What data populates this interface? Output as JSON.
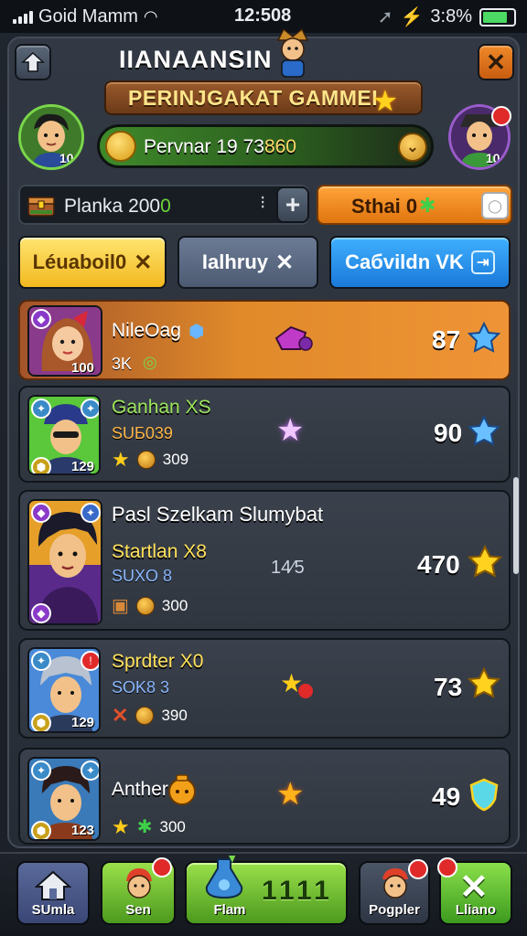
{
  "status": {
    "carrier": "Goid Mamm",
    "time": "12:508",
    "battery": "3:8%"
  },
  "header": {
    "title": "IIANAANSIN",
    "banner": "PERINJGAKAT GAMMEI"
  },
  "player": {
    "label": "Pervnar",
    "value_a": "19",
    "value_b": "73",
    "value_c": "860",
    "left_level": "10",
    "right_level": "10"
  },
  "plank": {
    "label": "Planka",
    "value_prefix": "200",
    "value_suffix": "0"
  },
  "stash": {
    "label": "Sthai 0"
  },
  "tabs": [
    {
      "label": "Léuaboil0",
      "x": "✕"
    },
    {
      "label": "Ialhruy",
      "x": "✕"
    },
    {
      "label": "Caбvildn VK",
      "x": "⇥"
    }
  ],
  "rows": [
    {
      "name": "NileOag",
      "sub": "3K",
      "level": "100",
      "score": "87"
    },
    {
      "name": "Ganhan",
      "tag": "XS",
      "sub": "SUБ039",
      "level": "129",
      "meta": "309",
      "score": "90"
    },
    {
      "title": "Pasl Szelkam Slumybat",
      "name": "Startlan",
      "tag": "X8",
      "sub": "SUXO 8",
      "level": "",
      "meta": "300",
      "mid": "14⁄5",
      "score": "470"
    },
    {
      "name": "Sprdter",
      "tag": "X0",
      "sub": "SOK8 3",
      "level": "129",
      "meta": "390",
      "score": "73"
    },
    {
      "name": "Anther",
      "level": "123",
      "meta": "300",
      "score": "49"
    }
  ],
  "nav": [
    {
      "label": "SUmla"
    },
    {
      "label": "Sen"
    },
    {
      "label": "Flam",
      "value": "1111"
    },
    {
      "label": "Pogpler"
    },
    {
      "label": "Lliano"
    }
  ],
  "colors": {
    "gold_row": "#e08a2a",
    "accent_green": "#6cd43a",
    "accent_blue": "#1a78d8",
    "accent_orange": "#f08a2a"
  }
}
